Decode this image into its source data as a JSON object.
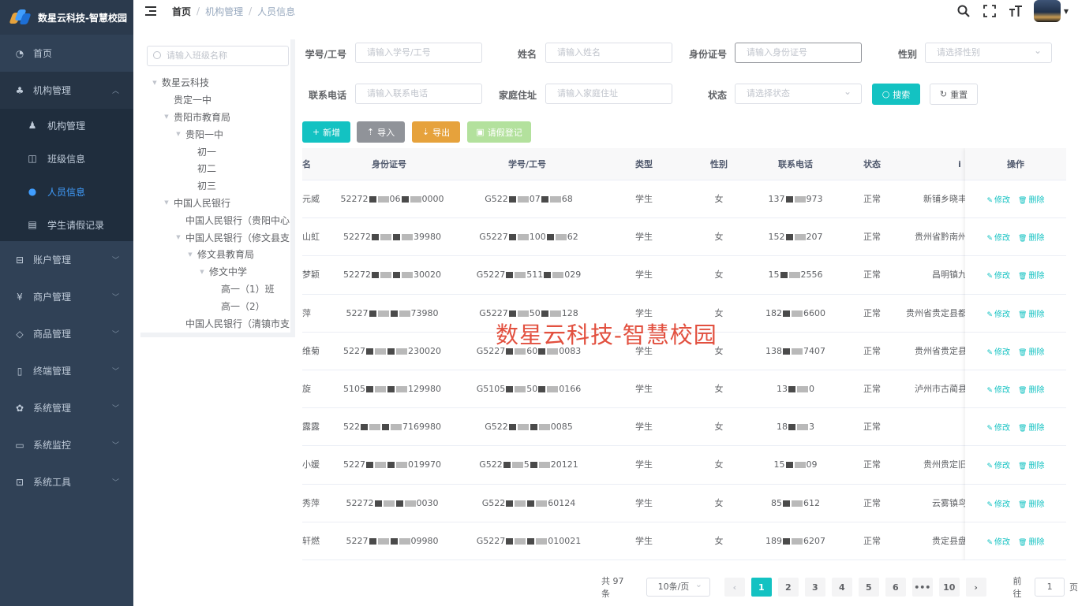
{
  "app": {
    "brand_title": "数星云科技-智慧校园",
    "watermark": "数星云科技-智慧校园"
  },
  "breadcrumb": [
    "首页",
    "机构管理",
    "人员信息"
  ],
  "sidebar": {
    "items": [
      {
        "label": "首页",
        "icon": "dashboard-icon"
      },
      {
        "label": "机构管理",
        "icon": "org-tree-icon",
        "open": true,
        "children": [
          {
            "label": "机构管理",
            "icon": "people-icon"
          },
          {
            "label": "班级信息",
            "icon": "table-icon"
          },
          {
            "label": "人员信息",
            "icon": "user-icon",
            "active": true
          },
          {
            "label": "学生请假记录",
            "icon": "clipboard-icon"
          }
        ]
      },
      {
        "label": "账户管理",
        "icon": "account-icon"
      },
      {
        "label": "商户管理",
        "icon": "yen-icon"
      },
      {
        "label": "商品管理",
        "icon": "goods-icon"
      },
      {
        "label": "终端管理",
        "icon": "phone-icon"
      },
      {
        "label": "系统管理",
        "icon": "gear-icon"
      },
      {
        "label": "系统监控",
        "icon": "monitor-icon"
      },
      {
        "label": "系统工具",
        "icon": "toolbox-icon"
      }
    ]
  },
  "tree": {
    "placeholder": "请输入班级名称",
    "nodes": [
      {
        "label": "数星云科技",
        "level": 0,
        "expandable": true
      },
      {
        "label": "贵定一中",
        "level": 1,
        "expandable": false
      },
      {
        "label": "贵阳市教育局",
        "level": 1,
        "expandable": true
      },
      {
        "label": "贵阳一中",
        "level": 2,
        "expandable": true
      },
      {
        "label": "初一",
        "level": 3,
        "expandable": false
      },
      {
        "label": "初二",
        "level": 3,
        "expandable": false
      },
      {
        "label": "初三",
        "level": 3,
        "expandable": false
      },
      {
        "label": "中国人民银行",
        "level": 1,
        "expandable": true
      },
      {
        "label": "中国人民银行（贵阳中心",
        "level": 2,
        "expandable": false
      },
      {
        "label": "中国人民银行（修文县支",
        "level": 2,
        "expandable": true
      },
      {
        "label": "修文县教育局",
        "level": 3,
        "expandable": true
      },
      {
        "label": "修文中学",
        "level": 4,
        "expandable": true
      },
      {
        "label": "高一（1）班",
        "level": 5,
        "expandable": false
      },
      {
        "label": "高一（2）",
        "level": 5,
        "expandable": false
      },
      {
        "label": "中国人民银行（清镇市支",
        "level": 2,
        "expandable": false
      }
    ]
  },
  "filters": {
    "id_label": "学号/工号",
    "id_placeholder": "请输入学号/工号",
    "name_label": "姓名",
    "name_placeholder": "请输入姓名",
    "idcard_label": "身份证号",
    "idcard_placeholder": "请输入身份证号",
    "gender_label": "性别",
    "gender_placeholder": "请选择性别",
    "phone_label": "联系电话",
    "phone_placeholder": "请输入联系电话",
    "address_label": "家庭住址",
    "address_placeholder": "请输入家庭住址",
    "status_label": "状态",
    "status_placeholder": "请选择状态",
    "search_label": "搜索",
    "reset_label": "重置"
  },
  "toolbar": {
    "add": "新增",
    "import": "导入",
    "export": "导出",
    "leave": "请假登记"
  },
  "table": {
    "headers": {
      "name": "名",
      "idcard": "身份证号",
      "sid": "学号/工号",
      "type": "类型",
      "gender": "性别",
      "phone": "联系电话",
      "status": "状态",
      "address": "i",
      "ops": "操作"
    },
    "edit_label": "修改",
    "delete_label": "删除",
    "rows": [
      {
        "name": "元威",
        "idcard": [
          "52272",
          "06",
          "0000"
        ],
        "sid": [
          "G522",
          "07",
          "68"
        ],
        "type": "学生",
        "gender": "女",
        "phone": [
          "137",
          "973"
        ],
        "status": "正常",
        "address": "新铺乡晓丰"
      },
      {
        "name": "山虹",
        "idcard": [
          "52272",
          "",
          "39980"
        ],
        "sid": [
          "G5227",
          "100",
          "62"
        ],
        "type": "学生",
        "gender": "女",
        "phone": [
          "152",
          "207"
        ],
        "status": "正常",
        "address": "贵州省黔南州"
      },
      {
        "name": "梦颖",
        "idcard": [
          "52272",
          "",
          "30020"
        ],
        "sid": [
          "G5227",
          "511",
          "029"
        ],
        "type": "学生",
        "gender": "女",
        "phone": [
          "15",
          "2556"
        ],
        "status": "正常",
        "address": "昌明镇九"
      },
      {
        "name": "萍",
        "idcard": [
          "5227",
          "",
          "73980"
        ],
        "sid": [
          "G5227",
          "50",
          "128"
        ],
        "type": "学生",
        "gender": "女",
        "phone": [
          "182",
          "6600"
        ],
        "status": "正常",
        "address": "贵州省贵定县都"
      },
      {
        "name": "维菊",
        "idcard": [
          "5227",
          "",
          "230020"
        ],
        "sid": [
          "G5227",
          "60",
          "0083"
        ],
        "type": "学生",
        "gender": "女",
        "phone": [
          "138",
          "7407"
        ],
        "status": "正常",
        "address": "贵州省贵定县"
      },
      {
        "name": "旋",
        "idcard": [
          "5105",
          "",
          "129980"
        ],
        "sid": [
          "G5105",
          "50",
          "0166"
        ],
        "type": "学生",
        "gender": "女",
        "phone": [
          "13",
          "0"
        ],
        "status": "正常",
        "address": "泸州市古蔺县"
      },
      {
        "name": "露露",
        "idcard": [
          "522",
          "",
          "7169980"
        ],
        "sid": [
          "G522",
          "",
          "0085"
        ],
        "type": "学生",
        "gender": "女",
        "phone": [
          "18",
          "3"
        ],
        "status": "正常",
        "address": ""
      },
      {
        "name": "小媛",
        "idcard": [
          "5227",
          "",
          "019970"
        ],
        "sid": [
          "G522",
          "5",
          "20121"
        ],
        "type": "学生",
        "gender": "女",
        "phone": [
          "15",
          "09"
        ],
        "status": "正常",
        "address": "贵州贵定旧"
      },
      {
        "name": "秀萍",
        "idcard": [
          "52272",
          "",
          "0030"
        ],
        "sid": [
          "G522",
          "",
          "60124"
        ],
        "type": "学生",
        "gender": "女",
        "phone": [
          "85",
          "612"
        ],
        "status": "正常",
        "address": "云雾镇鸟"
      },
      {
        "name": "轩燃",
        "idcard": [
          "5227",
          "",
          "09980"
        ],
        "sid": [
          "G5227",
          "",
          "010021"
        ],
        "type": "学生",
        "gender": "女",
        "phone": [
          "189",
          "6207"
        ],
        "status": "正常",
        "address": "贵定县盘"
      }
    ]
  },
  "pagination": {
    "total_text": "共 97 条",
    "page_size": "10条/页",
    "pages": [
      "1",
      "2",
      "3",
      "4",
      "5",
      "6",
      "•••",
      "10"
    ],
    "current": "1",
    "goto_prefix": "前往",
    "goto_value": "1",
    "goto_suffix": "页"
  },
  "colors": {
    "accent": "#13c2c2",
    "sidebar_bg": "#304156",
    "active_menu": "#409eff",
    "watermark": "#e2503f"
  }
}
